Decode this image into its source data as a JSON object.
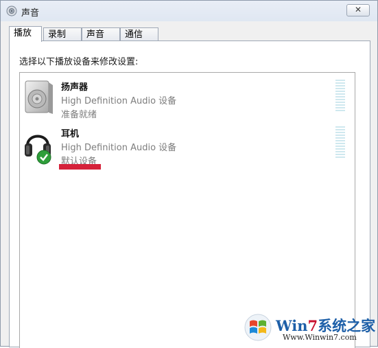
{
  "window": {
    "title": "声音",
    "close_label": "✕"
  },
  "tabs": [
    {
      "label": "播放",
      "active": true
    },
    {
      "label": "录制",
      "active": false
    },
    {
      "label": "声音",
      "active": false
    },
    {
      "label": "通信",
      "active": false
    }
  ],
  "panel": {
    "instruction": "选择以下播放设备来修改设置:"
  },
  "devices": [
    {
      "name": "扬声器",
      "driver": "High Definition Audio 设备",
      "status": "准备就绪",
      "icon": "speaker-icon"
    },
    {
      "name": "耳机",
      "driver": "High Definition Audio 设备",
      "status": "默认设备",
      "icon": "headphones-icon",
      "default": true
    }
  ],
  "colors": {
    "highlight_bar": "#d5223a",
    "meter": "#cfe8ef",
    "check": "#2e9e3a"
  },
  "watermark": {
    "brand_prefix": "Win",
    "brand_digit": "7",
    "brand_suffix": "系统之家",
    "url": "Www.Winwin7.com"
  }
}
